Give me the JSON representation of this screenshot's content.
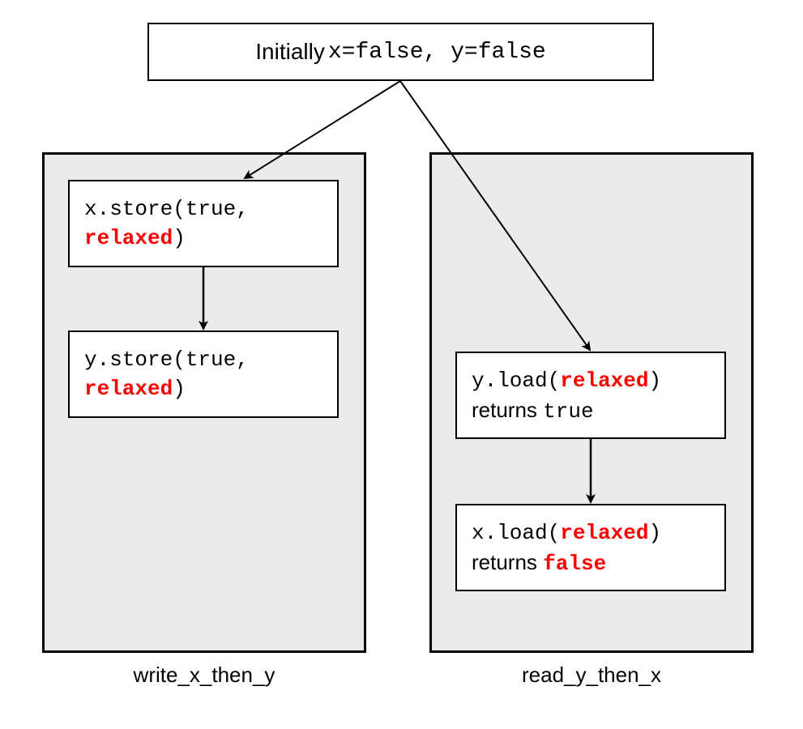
{
  "initial": {
    "prefix": "Initially ",
    "code": "x=false, y=false"
  },
  "left_thread": {
    "label": "write_x_then_y",
    "op1": {
      "line1_pre": "x.store(true,",
      "line2_kw": "relaxed",
      "line2_post": ")"
    },
    "op2": {
      "line1_pre": "y.store(true,",
      "line2_kw": "relaxed",
      "line2_post": ")"
    }
  },
  "right_thread": {
    "label": "read_y_then_x",
    "op1": {
      "line1_pre": "y.load(",
      "line1_kw": "relaxed",
      "line1_post": ")",
      "line2_pre": "returns ",
      "line2_val": "true"
    },
    "op2": {
      "line1_pre": "x.load(",
      "line1_kw": "relaxed",
      "line1_post": ")",
      "line2_pre": "returns ",
      "line2_val": "false"
    }
  }
}
